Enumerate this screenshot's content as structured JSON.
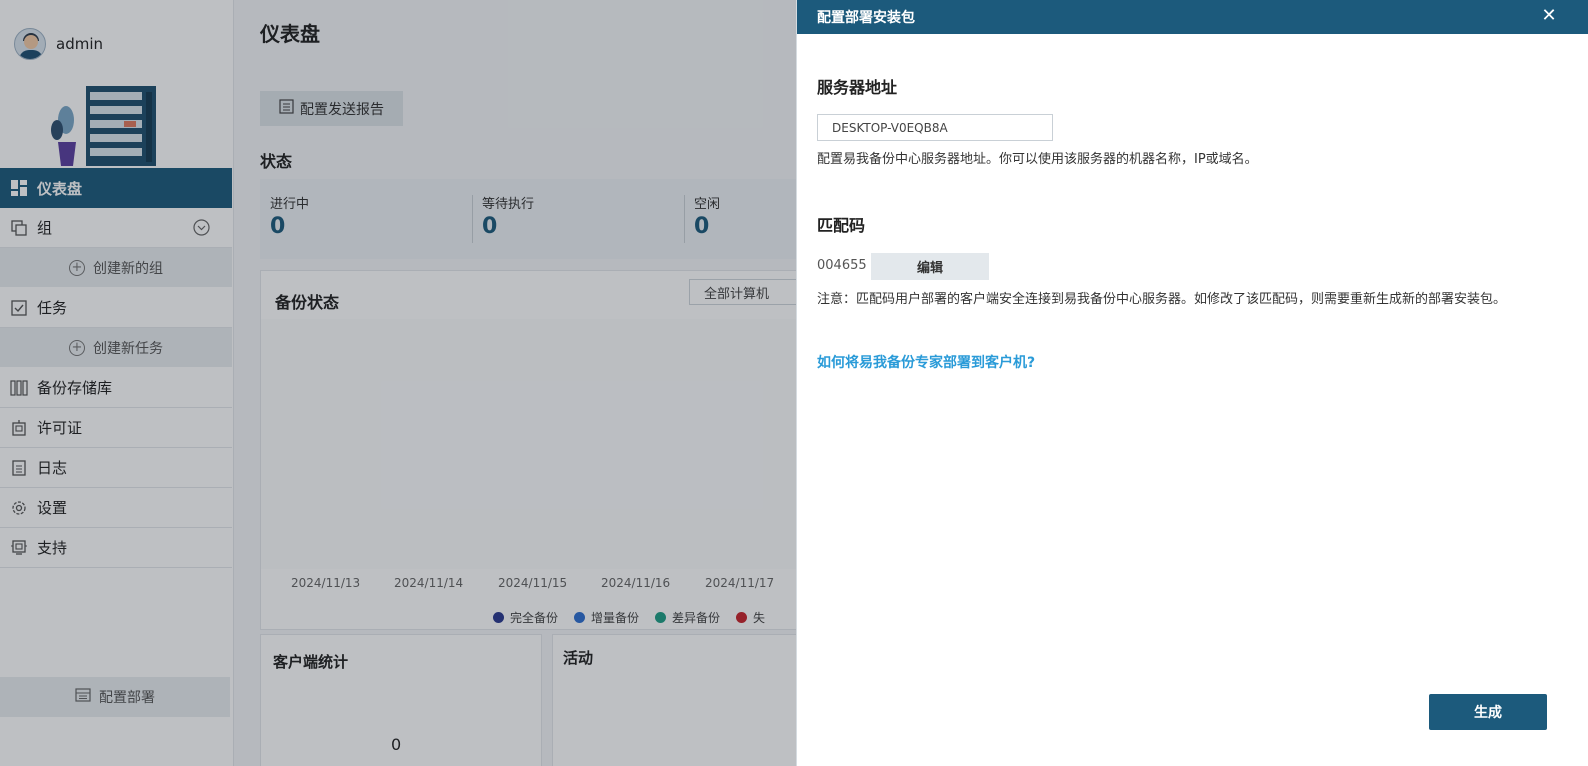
{
  "user": {
    "name": "admin"
  },
  "sidebar": {
    "items": [
      {
        "label": "仪表盘",
        "icon": "dashboard-icon"
      },
      {
        "label": "组",
        "icon": "group-icon"
      },
      {
        "label": "任务",
        "icon": "task-icon"
      },
      {
        "label": "备份存储库",
        "icon": "storage-icon"
      },
      {
        "label": "许可证",
        "icon": "license-icon"
      },
      {
        "label": "日志",
        "icon": "log-icon"
      },
      {
        "label": "设置",
        "icon": "gear-icon"
      },
      {
        "label": "支持",
        "icon": "support-icon"
      }
    ],
    "create_group": "创建新的组",
    "create_task": "创建新任务",
    "deploy": "配置部署"
  },
  "main": {
    "title": "仪表盘",
    "report_button": "配置发送报告",
    "status_title": "状态",
    "status": [
      {
        "label": "进行中",
        "value": "0"
      },
      {
        "label": "等待执行",
        "value": "0"
      },
      {
        "label": "空闲",
        "value": "0"
      }
    ],
    "backup_title": "备份状态",
    "computer_filter": "全部计算机",
    "dates": [
      "2024/11/13",
      "2024/11/14",
      "2024/11/15",
      "2024/11/16",
      "2024/11/17"
    ],
    "legend": [
      {
        "label": "完全备份",
        "color": "#2b3a8f"
      },
      {
        "label": "增量备份",
        "color": "#2f6fd0"
      },
      {
        "label": "差异备份",
        "color": "#1f9e85"
      },
      {
        "label": "失",
        "color": "#c8232c"
      }
    ],
    "client_title": "客户端统计",
    "client_value": "0",
    "activity_title": "活动"
  },
  "drawer": {
    "title": "配置部署安装包",
    "server_heading": "服务器地址",
    "server_value": "DESKTOP-V0EQB8A",
    "server_desc": "配置易我备份中心服务器地址。你可以使用该服务器的机器名称，IP或域名。",
    "code_heading": "匹配码",
    "code_value": "004655",
    "edit_label": "编辑",
    "note": "注意：匹配码用户部署的客户端安全连接到易我备份中心服务器。如修改了该匹配码，则需要重新生成新的部署安装包。",
    "help_link": "如何将易我备份专家部署到客户机?",
    "generate_label": "生成"
  }
}
